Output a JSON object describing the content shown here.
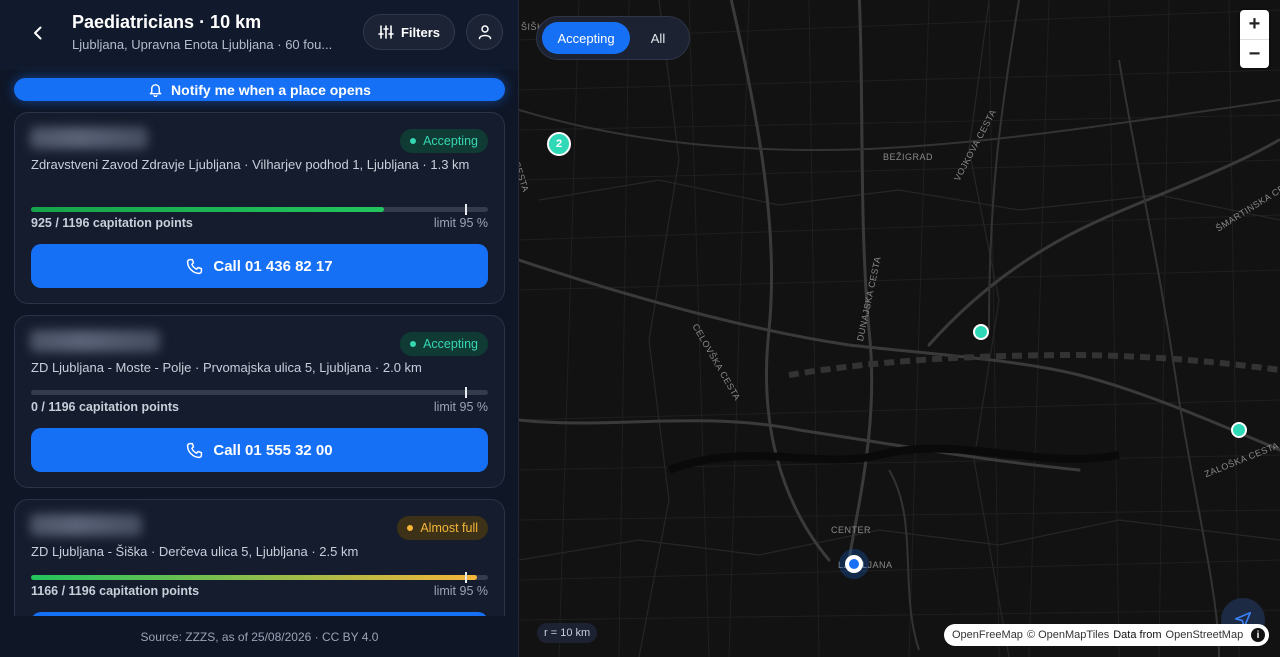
{
  "header": {
    "title": "Paediatricians · 10 km",
    "subtitle": "Ljubljana, Upravna Enota Ljubljana · 60 fou...",
    "filters_label": "Filters"
  },
  "notify": {
    "label": "Notify me when a place opens"
  },
  "cards": [
    {
      "status": "Accepting",
      "address": "Zdravstveni Zavod Zdravje Ljubljana · Vilharjev podhod 1, Ljubljana · 1.3 km",
      "points": "925 / 1196 capitation points",
      "points_fraction": 0.773,
      "limit": "limit 95 %",
      "limit_fraction": 0.95,
      "call": "Call 01 436 82 17"
    },
    {
      "status": "Accepting",
      "address": "ZD Ljubljana - Moste - Polje · Prvomajska ulica 5, Ljubljana · 2.0 km",
      "points": "0 / 1196 capitation points",
      "points_fraction": 0.0,
      "limit": "limit 95 %",
      "limit_fraction": 0.95,
      "call": "Call 01 555 32 00"
    },
    {
      "status": "Almost full",
      "address": "ZD Ljubljana - Šiška · Derčeva ulica 5, Ljubljana · 2.5 km",
      "points": "1166 / 1196 capitation points",
      "points_fraction": 0.975,
      "limit": "limit 95 %",
      "limit_fraction": 0.95,
      "call": ""
    }
  ],
  "footer": {
    "source": "Source: ZZZS, as of 25/08/2026 · CC BY 4.0"
  },
  "map": {
    "toggle": {
      "accepting": "Accepting",
      "all": "All"
    },
    "zoom_in": "+",
    "zoom_out": "−",
    "cluster_count": "2",
    "radius_label": "r = 10 km",
    "labels": {
      "bezigrad": "BEŽIGRAD",
      "vojkova": "VOJKOVA CESTA",
      "smartinska": "ŠMARTINSKA CESTA",
      "dunajska": "DUNAJSKA CESTA",
      "celovska": "CELOVŠKA CESTA",
      "zaloska": "ZALOŠKA CESTA",
      "center": "CENTER",
      "ljubljana": "LJUBLJANA",
      "siska": "ŠIŠKA",
      "cesta": "CESTA"
    },
    "attribution": {
      "openfreemap": "OpenFreeMap",
      "omt": "© OpenMapTiles",
      "data_from": "Data from",
      "osm": "OpenStreetMap",
      "info": "i"
    }
  },
  "colors": {
    "accent": "#1670f5",
    "accepting": "#37d6b2",
    "almost_full": "#f5b63a",
    "marker": "#2fd8b6"
  }
}
